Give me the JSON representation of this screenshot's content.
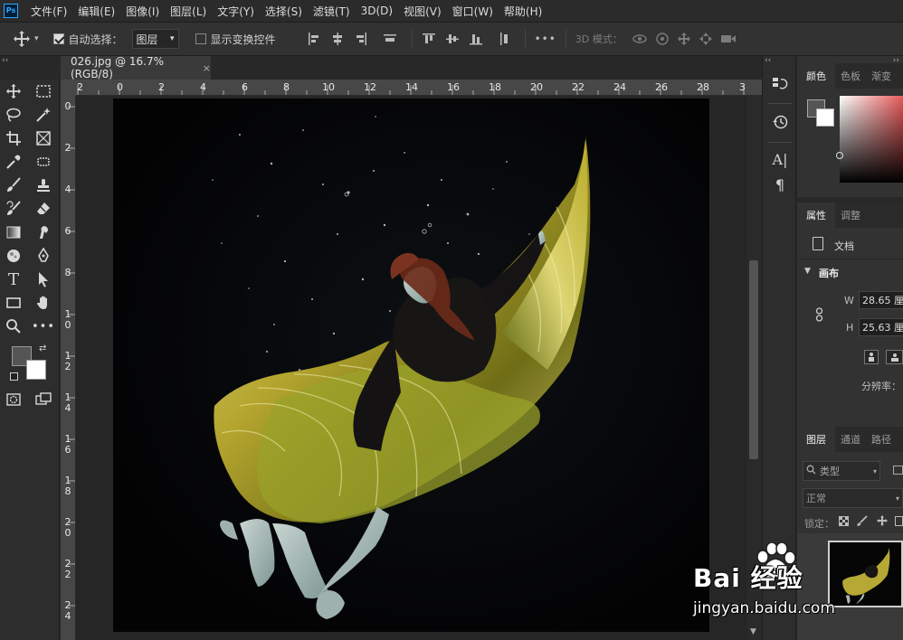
{
  "app": {
    "logo": "Ps"
  },
  "menu": [
    "文件(F)",
    "编辑(E)",
    "图像(I)",
    "图层(L)",
    "文字(Y)",
    "选择(S)",
    "滤镜(T)",
    "3D(D)",
    "视图(V)",
    "窗口(W)",
    "帮助(H)"
  ],
  "options": {
    "auto_select_label": "自动选择：",
    "auto_select_checked": true,
    "auto_select_value": "图层",
    "show_transform_label": "显示变换控件",
    "show_transform_checked": false,
    "more": "•••",
    "mode3d_label": "3D 模式："
  },
  "document": {
    "tab_title": "026.jpg @ 16.7%(RGB/8)",
    "close": "×",
    "panel_toggle": "‹‹"
  },
  "ruler": {
    "h_ticks": [
      "2",
      "0",
      "2",
      "4",
      "6",
      "8",
      "10",
      "12",
      "14",
      "16",
      "18",
      "20",
      "22",
      "24",
      "26",
      "28",
      "3"
    ],
    "v_ticks": [
      "0",
      "2",
      "4",
      "6",
      "8",
      "1\n0",
      "1\n2",
      "1\n4",
      "1\n6",
      "1\n8",
      "2\n0",
      "2\n2",
      "2\n4"
    ]
  },
  "tools": [
    "move-tool",
    "marquee-tool",
    "lasso-tool",
    "magic-wand-tool",
    "crop-tool",
    "frame-tool",
    "eyedropper-tool",
    "patch-tool",
    "brush-tool",
    "stamp-tool",
    "history-brush-tool",
    "eraser-tool",
    "gradient-tool",
    "smudge-tool",
    "dodge-tool",
    "pen-tool",
    "type-tool",
    "path-select-tool",
    "shape-tool",
    "hand-tool",
    "zoom-tool",
    "more-tools"
  ],
  "colors": {
    "foreground": "#555555",
    "background": "#ffffff",
    "accent": "#31a8ff"
  },
  "color_panel": {
    "tabs": [
      "颜色",
      "色板",
      "渐变"
    ]
  },
  "properties_panel": {
    "tabs": [
      "属性",
      "调整"
    ],
    "doc_label": "文档",
    "section": "画布",
    "w_label": "W",
    "w_value": "28.65 厘",
    "h_label": "H",
    "h_value": "25.63 厘",
    "resolution_label": "分辨率："
  },
  "layers_panel": {
    "tabs": [
      "图层",
      "通道",
      "路径"
    ],
    "filter_label": "类型",
    "blend_mode": "正常",
    "lock_label": "锁定："
  },
  "strip": {
    "type_icon": "A|",
    "para_icon": "¶"
  },
  "watermark": {
    "brand": "Bai 经验",
    "url": "jingyan.baidu.com"
  }
}
